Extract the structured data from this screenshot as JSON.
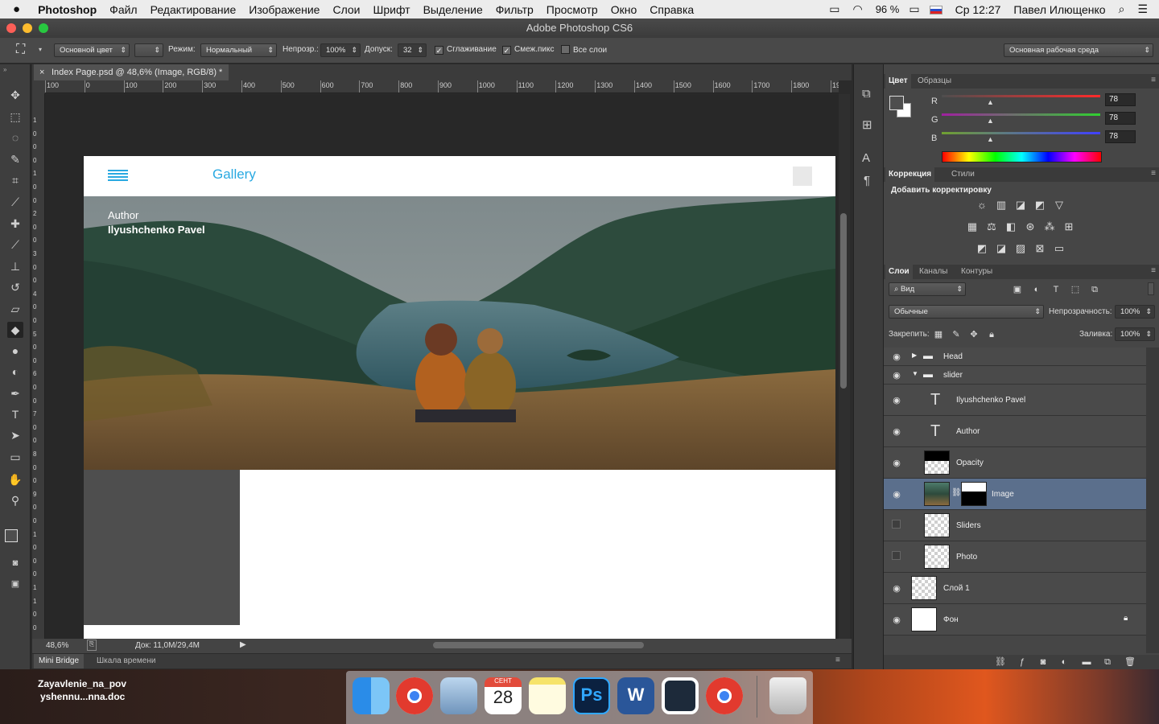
{
  "menubar": {
    "apple": "",
    "app_name": "Photoshop",
    "items": [
      "Файл",
      "Редактирование",
      "Изображение",
      "Слои",
      "Шрифт",
      "Выделение",
      "Фильтр",
      "Просмотр",
      "Окно",
      "Справка"
    ],
    "battery": "96 %",
    "clock": "Ср 12:27",
    "user": "Павел Илющенко"
  },
  "window": {
    "title": "Adobe Photoshop CS6"
  },
  "options": {
    "fill_source": "Основной цвет",
    "mode_label": "Режим:",
    "mode_value": "Нормальный",
    "opacity_label": "Непрозр.:",
    "opacity_value": "100%",
    "tolerance_label": "Допуск:",
    "tolerance_value": "32",
    "antialias_label": "Сглаживание",
    "contiguous_label": "Смеж.пикс",
    "all_layers_label": "Все слои",
    "workspace": "Основная рабочая среда"
  },
  "document": {
    "tab_title": "Index Page.psd @ 48,6% (Image, RGB/8) *",
    "ruler_h": [
      "100",
      "0",
      "100",
      "200",
      "300",
      "400",
      "500",
      "600",
      "700",
      "800",
      "900",
      "1000",
      "1100",
      "1200",
      "1300",
      "1400",
      "1500",
      "1600",
      "1700",
      "1800",
      "19"
    ],
    "ruler_v": [
      "1",
      "0",
      "0",
      "0",
      "1",
      "0",
      "0",
      "2",
      "0",
      "0",
      "3",
      "0",
      "0",
      "4",
      "0",
      "0",
      "5",
      "0",
      "0",
      "6",
      "0",
      "0",
      "7",
      "0",
      "0",
      "8",
      "0",
      "0",
      "9",
      "0",
      "0",
      "1",
      "0",
      "0",
      "0",
      "1",
      "1",
      "0",
      "0"
    ],
    "header_title": "Gallery",
    "hero_label": "Author",
    "hero_name": "Ilyushchenko Pavel"
  },
  "status": {
    "zoom": "48,6%",
    "doc_info": "Док: 11,0M/29,4M"
  },
  "bottom_tabs": [
    "Mini Bridge",
    "Шкала времени"
  ],
  "color_panel": {
    "tabs": [
      "Цвет",
      "Образцы"
    ],
    "channels": [
      {
        "name": "R",
        "value": "78"
      },
      {
        "name": "G",
        "value": "78"
      },
      {
        "name": "B",
        "value": "78"
      }
    ]
  },
  "adjust_panel": {
    "tabs": [
      "Коррекция",
      "Стили"
    ],
    "heading": "Добавить корректировку"
  },
  "layers_panel": {
    "tabs": [
      "Слои",
      "Каналы",
      "Контуры"
    ],
    "filter": "Вид",
    "blend_mode": "Обычные",
    "opacity_label": "Непрозрачность:",
    "opacity_value": "100%",
    "lock_label": "Закрепить:",
    "fill_label": "Заливка:",
    "fill_value": "100%",
    "layers": [
      {
        "name": "Head",
        "kind": "group-collapsed",
        "visible": true
      },
      {
        "name": "slider",
        "kind": "group-open",
        "visible": true
      },
      {
        "name": "Ilyushchenko Pavel",
        "kind": "text",
        "visible": true
      },
      {
        "name": "Author",
        "kind": "text",
        "visible": true
      },
      {
        "name": "Opacity",
        "kind": "raster",
        "visible": true
      },
      {
        "name": "Image",
        "kind": "masked",
        "visible": true,
        "selected": true
      },
      {
        "name": "Sliders",
        "kind": "raster",
        "visible": false
      },
      {
        "name": "Photo",
        "kind": "raster",
        "visible": false
      },
      {
        "name": "Слой 1",
        "kind": "raster",
        "visible": true
      },
      {
        "name": "Фон",
        "kind": "background",
        "visible": true,
        "locked": true
      }
    ]
  },
  "desktop": {
    "file_label_1": "Zayavlenie_na_pov",
    "file_label_2": "yshennu...nna.doc"
  },
  "dock": {
    "calendar_month": "СЕНТ",
    "calendar_day": "28",
    "apps": [
      "finder-icon",
      "chrome-icon",
      "mail-icon",
      "calendar-icon",
      "notes-icon",
      "photoshop-icon",
      "word-icon",
      "app-icon",
      "chrome-icon",
      "trash-icon"
    ]
  },
  "colors": {
    "accent": "#29a9e1",
    "selection": "#5b6f8c"
  }
}
